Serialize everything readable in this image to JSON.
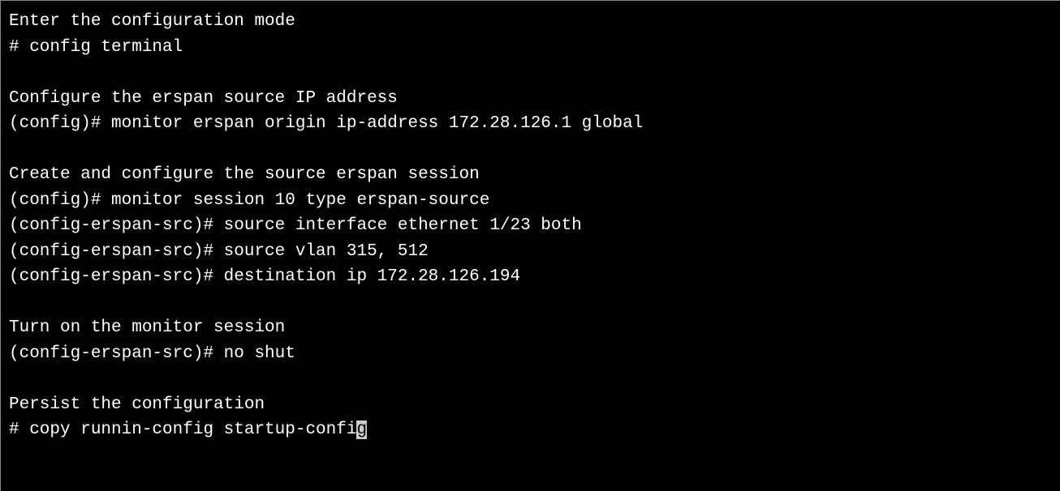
{
  "terminal": {
    "lines": [
      {
        "type": "text",
        "content": "Enter the configuration mode"
      },
      {
        "type": "text",
        "content": "# config terminal"
      },
      {
        "type": "blank"
      },
      {
        "type": "text",
        "content": "Configure the erspan source IP address"
      },
      {
        "type": "text",
        "content": "(config)# monitor erspan origin ip-address 172.28.126.1 global"
      },
      {
        "type": "blank"
      },
      {
        "type": "text",
        "content": "Create and configure the source erspan session"
      },
      {
        "type": "text",
        "content": "(config)# monitor session 10 type erspan-source"
      },
      {
        "type": "text",
        "content": "(config-erspan-src)# source interface ethernet 1/23 both"
      },
      {
        "type": "text",
        "content": "(config-erspan-src)# source vlan 315, 512"
      },
      {
        "type": "text",
        "content": "(config-erspan-src)# destination ip 172.28.126.194"
      },
      {
        "type": "blank"
      },
      {
        "type": "text",
        "content": "Turn on the monitor session"
      },
      {
        "type": "text",
        "content": "(config-erspan-src)# no shut"
      },
      {
        "type": "blank"
      },
      {
        "type": "text",
        "content": "Persist the configuration"
      },
      {
        "type": "cursor",
        "content": "# copy runnin-config startup-confi",
        "last_char": "g"
      }
    ]
  }
}
